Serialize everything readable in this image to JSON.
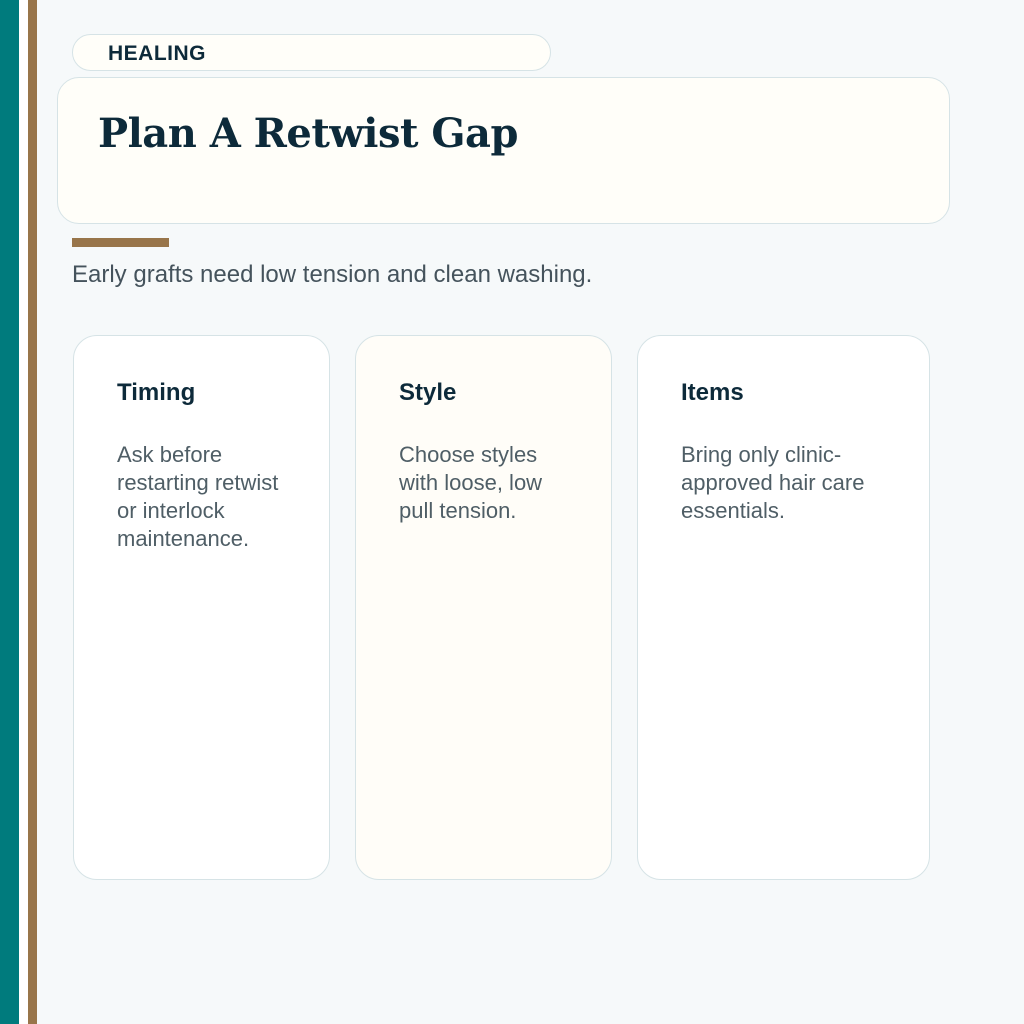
{
  "colors": {
    "teal": "#007b7d",
    "brown": "#98754a",
    "page_bg": "#f6f9fa",
    "card_cream": "#fffef9",
    "ink": "#0d2a3a",
    "muted": "#45535c"
  },
  "tag": {
    "label": "HEALING"
  },
  "hero": {
    "title": "Plan A Retwist Gap"
  },
  "subtitle": "Early grafts need low tension and clean washing.",
  "cards": [
    {
      "title": "Timing",
      "body": "Ask before restarting retwist or interlock maintenance."
    },
    {
      "title": "Style",
      "body": "Choose styles with loose, low pull tension."
    },
    {
      "title": "Items",
      "body": "Bring only clinic-approved hair care essentials."
    }
  ]
}
